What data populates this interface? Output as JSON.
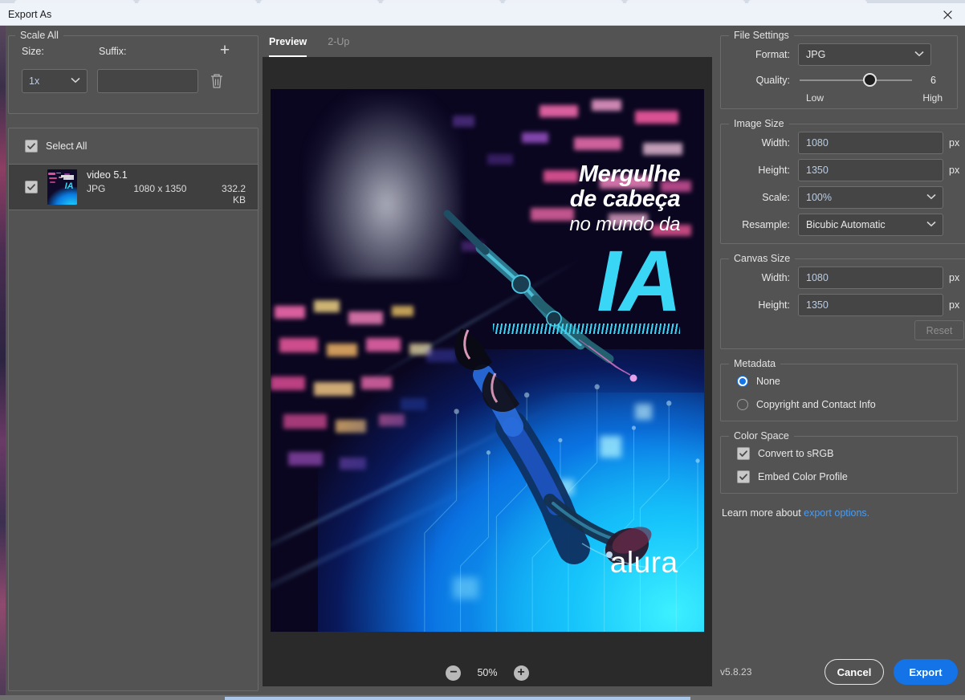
{
  "window": {
    "title": "Export As",
    "close_label": "✕"
  },
  "scale_all": {
    "legend": "Scale All",
    "size_label": "Size:",
    "suffix_label": "Suffix:",
    "add_label": "+",
    "size_value": "1x",
    "suffix_value": "",
    "suffix_placeholder": "",
    "delete_icon": "trash-icon"
  },
  "files": {
    "select_all_label": "Select All",
    "columns": [
      "name",
      "format",
      "dimensions",
      "size"
    ],
    "rows": [
      {
        "name": "video 5.1",
        "format": "JPG",
        "dimensions": "1080 x 1350",
        "size": "332.2 KB",
        "checked": true
      }
    ]
  },
  "preview": {
    "tabs": [
      {
        "label": "Preview",
        "active": true
      },
      {
        "label": "2-Up",
        "active": false
      }
    ],
    "zoom_out_label": "−",
    "zoom_in_label": "+",
    "zoom_level": "50%",
    "artwork": {
      "line1": "Mergulhe",
      "line2": "de cabeça",
      "line3": "no mundo da",
      "headline": "IA",
      "brand": "alura",
      "accent_color": "#3ad6f5",
      "background_color": "#0a0620"
    }
  },
  "file_settings": {
    "legend": "File Settings",
    "format_label": "Format:",
    "format_value": "JPG",
    "quality_label": "Quality:",
    "quality_value": "6",
    "quality_min_label": "Low",
    "quality_max_label": "High",
    "quality_percent": 62
  },
  "image_size": {
    "legend": "Image Size",
    "width_label": "Width:",
    "width_value": "1080",
    "width_unit": "px",
    "height_label": "Height:",
    "height_value": "1350",
    "height_unit": "px",
    "scale_label": "Scale:",
    "scale_value": "100%",
    "resample_label": "Resample:",
    "resample_value": "Bicubic Automatic"
  },
  "canvas_size": {
    "legend": "Canvas Size",
    "width_label": "Width:",
    "width_value": "1080",
    "width_unit": "px",
    "height_label": "Height:",
    "height_value": "1350",
    "height_unit": "px",
    "reset_label": "Reset"
  },
  "metadata": {
    "legend": "Metadata",
    "options": [
      {
        "label": "None",
        "selected": true
      },
      {
        "label": "Copyright and Contact Info",
        "selected": false
      }
    ]
  },
  "color_space": {
    "legend": "Color Space",
    "options": [
      {
        "label": "Convert to sRGB",
        "checked": true
      },
      {
        "label": "Embed Color Profile",
        "checked": true
      }
    ]
  },
  "learn_more": {
    "prefix": "Learn more about ",
    "link": "export options."
  },
  "footer": {
    "version": "v5.8.23",
    "cancel_label": "Cancel",
    "export_label": "Export",
    "accent_color": "#1473e6"
  }
}
